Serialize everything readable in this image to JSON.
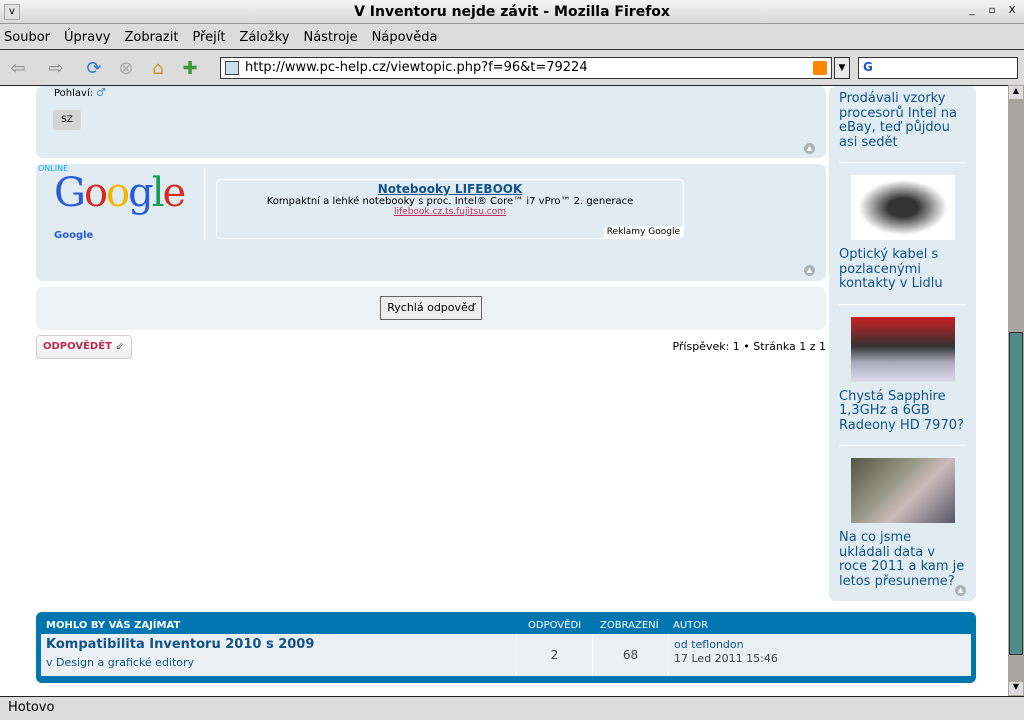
{
  "window": {
    "title": "V Inventoru nejde závit - Mozilla Firefox"
  },
  "menu": [
    "Soubor",
    "Úpravy",
    "Zobrazit",
    "Přejít",
    "Záložky",
    "Nástroje",
    "Nápověda"
  ],
  "toolbar": {
    "url": "http://www.pc-help.cz/viewtopic.php?f=96&t=79224"
  },
  "post": {
    "gender_label": "Pohlaví:",
    "badge": "SZ"
  },
  "ad": {
    "online": "ONLINE",
    "google_name": "Google",
    "title": "Notebooky LIFEBOOK",
    "text": "Kompaktní a lehké notebooky s proc. Intel® Core™ i7 vPro™ 2. generace",
    "link": "lifebook.cz.ts.fujitsu.com",
    "ads_by": "Reklamy Google"
  },
  "quick_reply": "Rychlá odpověď",
  "reply_button": "ODPOVĚDĚT",
  "pagination": "Příspěvek: 1 • Stránka 1 z 1",
  "sidebar": {
    "items": [
      {
        "title": "Prodávali vzorky procesorů Intel na eBay, teď půjdou asi sedět"
      },
      {
        "title": "Optický kabel s pozlacenými kontakty v Lidlu"
      },
      {
        "title": "Chystá Sapphire 1,3GHz a 6GB Radeony HD 7970?"
      },
      {
        "title": "Na co jsme ukládali data v roce 2011 a kam je letos přesuneme?"
      }
    ]
  },
  "related": {
    "heading": "MOHLO BY VÁS ZAJÍMAT",
    "col_replies": "ODPOVĚDI",
    "col_views": "ZOBRAZENÍ",
    "col_author": "AUTOR",
    "rows": [
      {
        "title": "Kompatibilita Inventoru 2010 s 2009",
        "forum": "v Design a grafické editory",
        "replies": "2",
        "views": "68",
        "author": "od teflondon",
        "date": "17 Led 2011 15:46"
      }
    ]
  },
  "status": "Hotovo"
}
